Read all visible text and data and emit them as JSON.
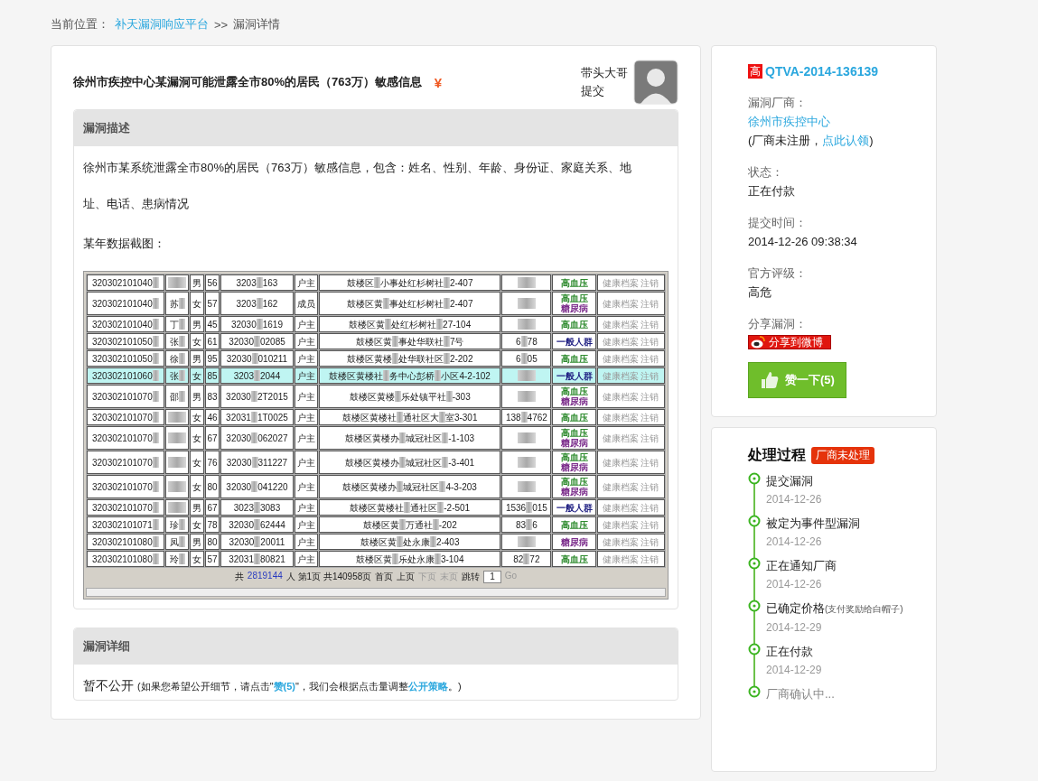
{
  "breadcrumb": {
    "label": "当前位置：",
    "link": "补天漏洞响应平台",
    "separator": ">>",
    "current": "漏洞详情"
  },
  "vuln": {
    "title": "徐州市疾控中心某漏洞可能泄露全市80%的居民（763万）敏感信息",
    "reward_mark": "¥",
    "submitter": "带头大哥",
    "submitter_action": "提交"
  },
  "description": {
    "heading": "漏洞描述",
    "paragraphs": [
      "徐州市某系统泄露全市80%的居民（763万）敏感信息，包含：姓名、性别、年龄、身份证、家庭关系、地址、电话、患病情况",
      "某年数据截图："
    ]
  },
  "screenshot_table": {
    "rows": [
      {
        "selected": false,
        "cells": [
          [
            "320302101040"
          ],
          [],
          [
            "男"
          ],
          [
            "56"
          ],
          [
            "3203",
            "163"
          ],
          [
            "户主"
          ],
          [
            "鼓楼区",
            "小事处红杉树社",
            "2-407"
          ],
          [],
          [
            {
              "text": "高血压",
              "color": "#2e8b2e"
            }
          ],
          [
            "健康档案",
            "注销"
          ]
        ]
      },
      {
        "selected": false,
        "cells": [
          [
            "320302101040"
          ],
          [
            "苏"
          ],
          [
            "女"
          ],
          [
            "57"
          ],
          [
            "3203",
            "162"
          ],
          [
            "成员"
          ],
          [
            "鼓楼区黄",
            "事处红杉树社",
            "2-407"
          ],
          [],
          [
            {
              "text": "高血压",
              "color": "#2e8b2e"
            },
            {
              "text": "糖尿病",
              "color": "#7a2a8a"
            }
          ],
          [
            "健康档案",
            "注销"
          ]
        ]
      },
      {
        "selected": false,
        "cells": [
          [
            "320302101040"
          ],
          [
            "丁"
          ],
          [
            "男"
          ],
          [
            "45"
          ],
          [
            "32030",
            "1619"
          ],
          [
            "户主"
          ],
          [
            "鼓楼区黄",
            "处红杉树社",
            "27-104"
          ],
          [],
          [
            {
              "text": "高血压",
              "color": "#2e8b2e"
            }
          ],
          [
            "健康档案",
            "注销"
          ]
        ]
      },
      {
        "selected": false,
        "cells": [
          [
            "320302101050"
          ],
          [
            "张"
          ],
          [
            "女"
          ],
          [
            "61"
          ],
          [
            "32030",
            "02085"
          ],
          [
            "户主"
          ],
          [
            "鼓楼区黄",
            "事处华联社",
            "7号"
          ],
          [
            "6",
            "78"
          ],
          [
            {
              "text": "一般人群",
              "color": "#1c1c80"
            }
          ],
          [
            "健康档案",
            "注销"
          ]
        ]
      },
      {
        "selected": false,
        "cells": [
          [
            "320302101050"
          ],
          [
            "徐"
          ],
          [
            "男"
          ],
          [
            "95"
          ],
          [
            "32030",
            "010211"
          ],
          [
            "户主"
          ],
          [
            "鼓楼区黄楼",
            "处华联社区",
            "2-202"
          ],
          [
            "6",
            "05"
          ],
          [
            {
              "text": "高血压",
              "color": "#2e8b2e"
            }
          ],
          [
            "健康档案",
            "注销"
          ]
        ]
      },
      {
        "selected": true,
        "cells": [
          [
            "320302101060"
          ],
          [
            "张"
          ],
          [
            "女"
          ],
          [
            "85"
          ],
          [
            "3203",
            "2044"
          ],
          [
            "户主"
          ],
          [
            "鼓楼区黄楼社",
            "务中心彭桥",
            "小区4-2-102"
          ],
          [],
          [
            {
              "text": "一般人群",
              "color": "#1c1c80"
            }
          ],
          [
            "健康档案",
            "注销"
          ]
        ]
      },
      {
        "selected": false,
        "cells": [
          [
            "320302101070"
          ],
          [
            "邵"
          ],
          [
            "男"
          ],
          [
            "83"
          ],
          [
            "32030",
            "2T2015"
          ],
          [
            "户主"
          ],
          [
            "鼓楼区黄楼",
            "乐处镇平社",
            "-303"
          ],
          [],
          [
            {
              "text": "高血压",
              "color": "#2e8b2e"
            },
            {
              "text": "糖尿病",
              "color": "#7a2a8a"
            }
          ],
          [
            "健康档案",
            "注销"
          ]
        ]
      },
      {
        "selected": false,
        "cells": [
          [
            "320302101070"
          ],
          [],
          [
            "女"
          ],
          [
            "46"
          ],
          [
            "32031",
            "1T0025"
          ],
          [
            "户主"
          ],
          [
            "鼓楼区黄楼社",
            "通社区大",
            "室3-301"
          ],
          [
            "138",
            "4762"
          ],
          [
            {
              "text": "高血压",
              "color": "#2e8b2e"
            }
          ],
          [
            "健康档案",
            "注销"
          ]
        ]
      },
      {
        "selected": false,
        "cells": [
          [
            "320302101070"
          ],
          [],
          [
            "女"
          ],
          [
            "67"
          ],
          [
            "32030",
            "062027"
          ],
          [
            "户主"
          ],
          [
            "鼓楼区黄楼办",
            "城冠社区",
            "-1-103"
          ],
          [],
          [
            {
              "text": "高血压",
              "color": "#2e8b2e"
            },
            {
              "text": "糖尿病",
              "color": "#7a2a8a"
            }
          ],
          [
            "健康档案",
            "注销"
          ]
        ]
      },
      {
        "selected": false,
        "cells": [
          [
            "320302101070"
          ],
          [],
          [
            "女"
          ],
          [
            "76"
          ],
          [
            "32030",
            "311227"
          ],
          [
            "户主"
          ],
          [
            "鼓楼区黄楼办",
            "城冠社区",
            "-3-401"
          ],
          [],
          [
            {
              "text": "高血压",
              "color": "#2e8b2e"
            },
            {
              "text": "糖尿病",
              "color": "#7a2a8a"
            }
          ],
          [
            "健康档案",
            "注销"
          ]
        ]
      },
      {
        "selected": false,
        "cells": [
          [
            "320302101070"
          ],
          [],
          [
            "女"
          ],
          [
            "80"
          ],
          [
            "32030",
            "041220"
          ],
          [
            "户主"
          ],
          [
            "鼓楼区黄楼办",
            "城冠社区",
            "4-3-203"
          ],
          [],
          [
            {
              "text": "高血压",
              "color": "#2e8b2e"
            },
            {
              "text": "糖尿病",
              "color": "#7a2a8a"
            }
          ],
          [
            "健康档案",
            "注销"
          ]
        ]
      },
      {
        "selected": false,
        "cells": [
          [
            "320302101070"
          ],
          [],
          [
            "男"
          ],
          [
            "67"
          ],
          [
            "3023",
            "3083"
          ],
          [
            "户主"
          ],
          [
            "鼓楼区黄楼社",
            "通社区",
            "-2-501"
          ],
          [
            "1536",
            "015"
          ],
          [
            {
              "text": "一般人群",
              "color": "#1c1c80"
            }
          ],
          [
            "健康档案",
            "注销"
          ]
        ]
      },
      {
        "selected": false,
        "cells": [
          [
            "320302101071"
          ],
          [
            "珍"
          ],
          [
            "女"
          ],
          [
            "78"
          ],
          [
            "32030",
            "62444"
          ],
          [
            "户主"
          ],
          [
            "鼓楼区黄",
            "万通社",
            "-202"
          ],
          [
            "83",
            "6"
          ],
          [
            {
              "text": "高血压",
              "color": "#2e8b2e"
            }
          ],
          [
            "健康档案",
            "注销"
          ]
        ]
      },
      {
        "selected": false,
        "cells": [
          [
            "320302101080"
          ],
          [
            "凤"
          ],
          [
            "男"
          ],
          [
            "80"
          ],
          [
            "32030",
            "20011"
          ],
          [
            "户主"
          ],
          [
            "鼓楼区黄",
            "处永康",
            "2-403"
          ],
          [],
          [
            {
              "text": "糖尿病",
              "color": "#7a2a8a"
            }
          ],
          [
            "健康档案",
            "注销"
          ]
        ]
      },
      {
        "selected": false,
        "cells": [
          [
            "320302101080"
          ],
          [
            "玲"
          ],
          [
            "女"
          ],
          [
            "57"
          ],
          [
            "32031",
            "80821"
          ],
          [
            "户主"
          ],
          [
            "鼓楼区黄",
            "乐处永康",
            "3-104"
          ],
          [
            "82",
            "72"
          ],
          [
            {
              "text": "高血压",
              "color": "#2e8b2e"
            }
          ],
          [
            "健康档案",
            "注销"
          ]
        ]
      }
    ],
    "pager": [
      {
        "text": "共",
        "kind": "text"
      },
      {
        "text": "2819144",
        "kind": "count"
      },
      {
        "text": "人 第1页 共140958页",
        "kind": "text"
      },
      {
        "text": "首页",
        "kind": "link"
      },
      {
        "text": "上页",
        "kind": "link"
      },
      {
        "text": "下页",
        "kind": "disabled"
      },
      {
        "text": "末页",
        "kind": "disabled"
      },
      {
        "text": "跳转",
        "kind": "text"
      },
      {
        "text": "1",
        "kind": "input"
      },
      {
        "text": "Go",
        "kind": "disabled"
      }
    ]
  },
  "detail": {
    "heading": "漏洞详细",
    "status": "暂不公开",
    "note": [
      {
        "kind": "text",
        "text": "(如果您希望公开细节，请点击\""
      },
      {
        "kind": "link",
        "text": "赞(5)"
      },
      {
        "kind": "text",
        "text": "\"，我们会根据点击量调整"
      },
      {
        "kind": "link",
        "text": "公开策略"
      },
      {
        "kind": "text",
        "text": "。)"
      }
    ]
  },
  "sidebar": {
    "level_badge": "高",
    "vuln_id": "QTVA-2014-136139",
    "fields": [
      {
        "label": "漏洞厂商：",
        "kind": "vendor",
        "link": "徐州市疾控中心",
        "note": [
          {
            "kind": "text",
            "text": "(厂商未注册，"
          },
          {
            "kind": "link",
            "text": "点此认领"
          },
          {
            "kind": "text",
            "text": ")"
          }
        ]
      },
      {
        "label": "状态：",
        "kind": "text",
        "value": "正在付款"
      },
      {
        "label": "提交时间：",
        "kind": "text",
        "value": "2014-12-26 09:38:34"
      },
      {
        "label": "官方评级：",
        "kind": "text",
        "value": "高危"
      },
      {
        "label": "分享漏洞：",
        "kind": "share",
        "value": "分享到微博"
      }
    ],
    "like_button": "赞一下(5)"
  },
  "process": {
    "title": "处理过程",
    "badge": "厂商未处理",
    "steps": [
      {
        "title": "提交漏洞",
        "date": "2014-12-26",
        "done": true
      },
      {
        "title": "被定为事件型漏洞",
        "date": "2014-12-26",
        "done": true
      },
      {
        "title": "正在通知厂商",
        "date": "2014-12-26",
        "done": true
      },
      {
        "title": "已确定价格",
        "note": "(支付奖励给白帽子)",
        "date": "2014-12-29",
        "done": true
      },
      {
        "title": "正在付款",
        "date": "2014-12-29",
        "done": true
      },
      {
        "title": "厂商确认中...",
        "done": false
      }
    ]
  }
}
